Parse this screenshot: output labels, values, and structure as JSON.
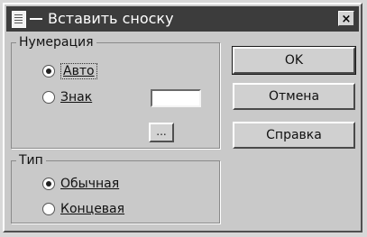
{
  "window": {
    "title": "Вставить сноску",
    "close_glyph": "×",
    "title_icon": "document-icon"
  },
  "numbering": {
    "legend": "Нумерация",
    "auto_label": "Авто",
    "auto_checked": true,
    "symbol_label": "Знак",
    "symbol_checked": false,
    "symbol_value": "",
    "symbol_button_label": "..."
  },
  "type": {
    "legend": "Тип",
    "footnote_label": "Обычная",
    "footnote_checked": true,
    "endnote_label": "Концевая",
    "endnote_checked": false
  },
  "buttons": {
    "ok": "OK",
    "cancel": "Отмена",
    "help": "Справка"
  }
}
